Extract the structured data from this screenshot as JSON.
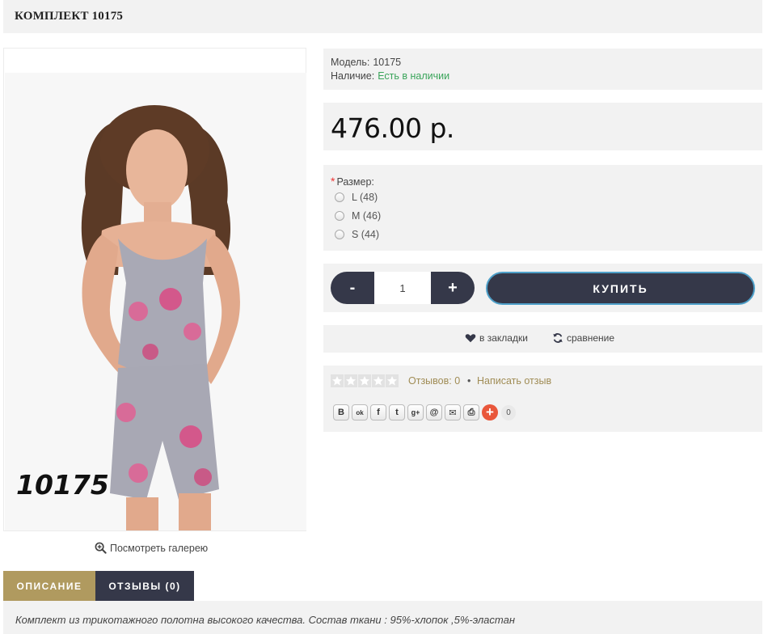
{
  "page": {
    "title": "КОМПЛЕКТ 10175"
  },
  "product_image": {
    "overlay_label": "10175"
  },
  "gallery": {
    "label": "Посмотреть галерею"
  },
  "info": {
    "model_label": "Модель:",
    "model_value": "10175",
    "stock_label": "Наличие:",
    "stock_value": "Есть в наличии",
    "stock_color": "#3aa45a"
  },
  "price": "476.00 р.",
  "options": {
    "title": "Размер:",
    "required_mark": "*",
    "items": [
      {
        "label": "L (48)",
        "selected": false
      },
      {
        "label": "M (46)",
        "selected": false
      },
      {
        "label": "S (44)",
        "selected": false
      }
    ]
  },
  "cart": {
    "minus_label": "-",
    "plus_label": "+",
    "quantity": "1",
    "buy_label": "КУПИТЬ"
  },
  "actions": {
    "wishlist_label": "в закладки",
    "compare_label": "сравнение"
  },
  "reviews": {
    "rating": 0,
    "max_rating": 5,
    "count_label": "Отзывов: 0",
    "separator": "•",
    "write_label": "Написать отзыв"
  },
  "share": {
    "buttons": [
      {
        "icon": "vk-icon",
        "glyph": "В"
      },
      {
        "icon": "odnoklassniki-icon",
        "glyph": "ok"
      },
      {
        "icon": "facebook-icon",
        "glyph": "f"
      },
      {
        "icon": "twitter-icon",
        "glyph": "t"
      },
      {
        "icon": "google-plus-icon",
        "glyph": "g+"
      },
      {
        "icon": "mail-ru-icon",
        "glyph": "@"
      },
      {
        "icon": "email-icon",
        "glyph": "✉"
      },
      {
        "icon": "print-icon",
        "glyph": "⎙"
      }
    ],
    "count": "0"
  },
  "tabs": [
    {
      "label": "ОПИСАНИЕ",
      "active": true
    },
    {
      "label": "ОТЗЫВЫ (0)",
      "active": false
    }
  ],
  "description": "Комплект из трикотажного полотна высокого качества. Состав ткани : 95%-хлопок ,5%-эластан",
  "colors": {
    "dark_button": "#353849",
    "accent_gold": "#b09a5f",
    "link_gold": "#a08c55",
    "panel_bg": "#f2f2f2"
  }
}
